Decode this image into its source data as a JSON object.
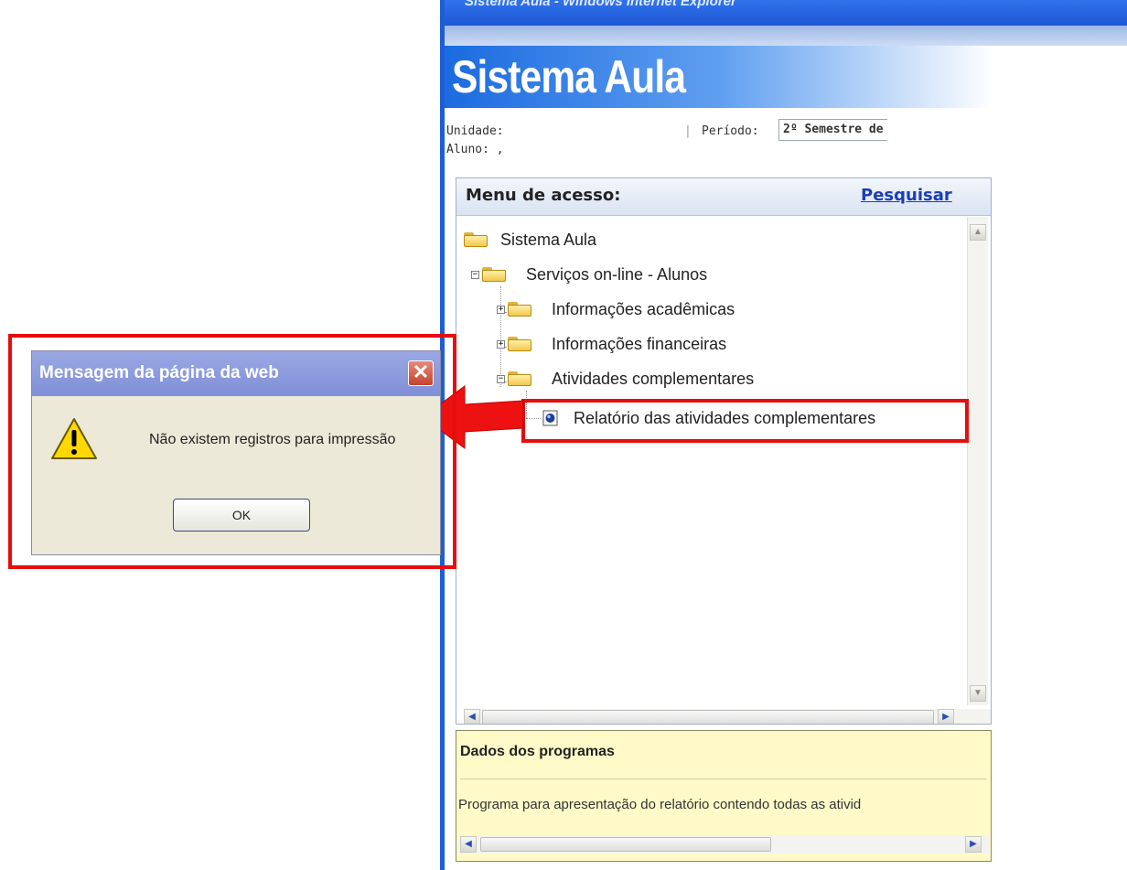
{
  "browser": {
    "window_title": "Sistema Aula - Windows Internet Explorer",
    "app_title": "Sistema Aula",
    "unidade_label": "Unidade:",
    "aluno_label": "Aluno: ,",
    "separator": "|",
    "periodo_label": "Período:",
    "periodo_value": "2º Semestre de"
  },
  "menu": {
    "title": "Menu de acesso:",
    "search_link": "Pesquisar",
    "items": [
      {
        "label": "Sistema Aula"
      },
      {
        "label": "Serviços on-line - Alunos",
        "expander": "−"
      },
      {
        "label": "Informações acadêmicas",
        "expander": "+"
      },
      {
        "label": "Informações financeiras",
        "expander": "+"
      },
      {
        "label": "Atividades complementares",
        "expander": "−"
      },
      {
        "label": "Relatório das atividades complementares"
      }
    ]
  },
  "dados": {
    "title": "Dados dos programas",
    "text": "Programa para apresentação do relatório contendo todas as ativid"
  },
  "dialog": {
    "title": "Mensagem da página da web",
    "message": "Não existem registros para impressão",
    "ok_label": "OK",
    "close_glyph": "✕"
  },
  "colors": {
    "highlight": "#e80c0c",
    "banner_blue": "#1b6be0"
  }
}
